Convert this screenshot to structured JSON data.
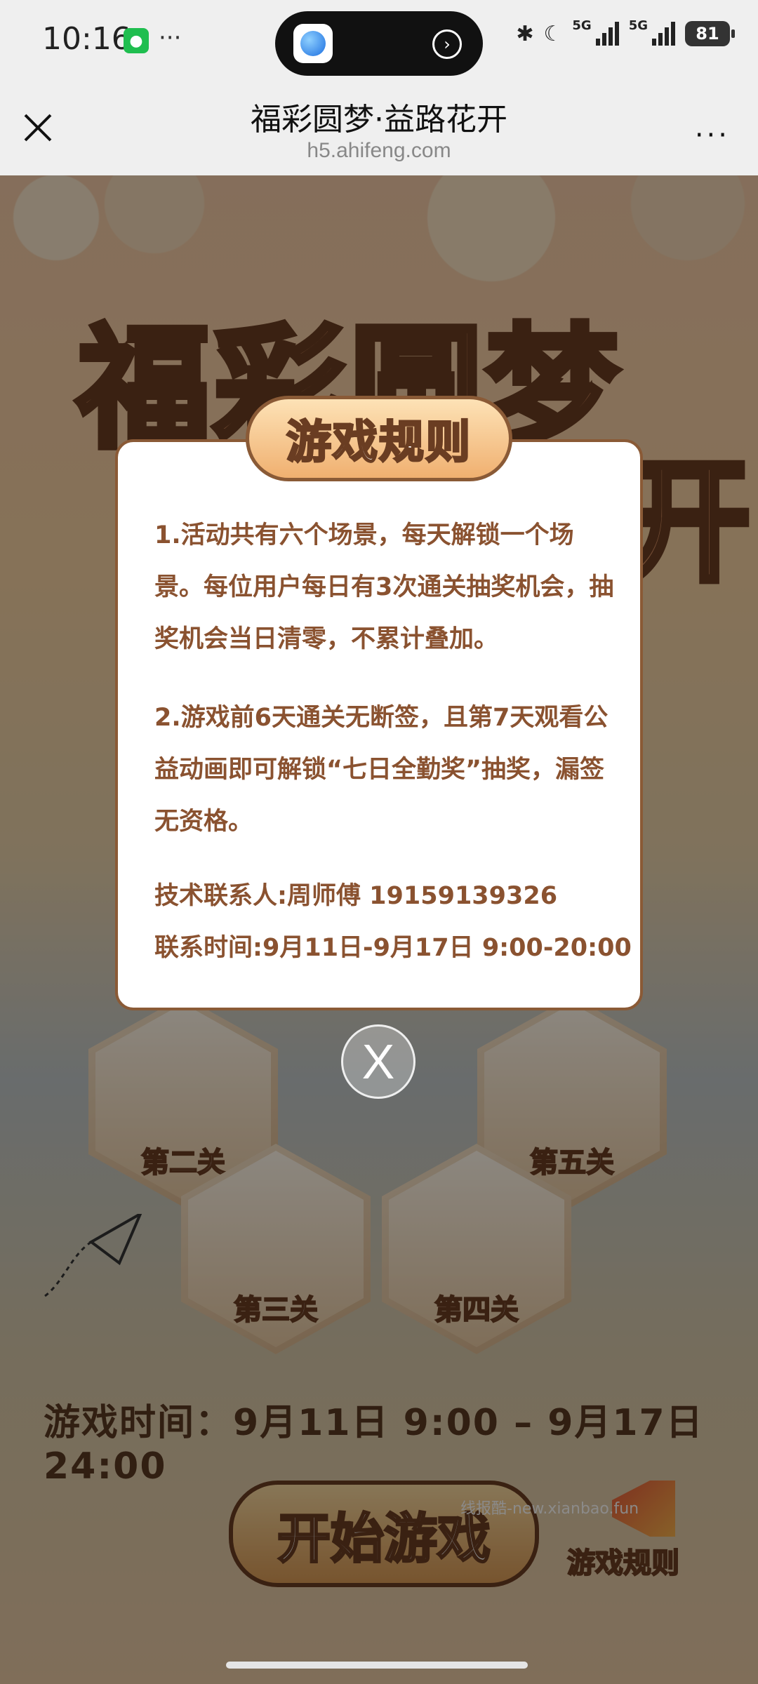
{
  "status_bar": {
    "time": "10:16",
    "more": "···",
    "net1": "5G",
    "net2": "5G",
    "battery": "81"
  },
  "navbar": {
    "title": "福彩圆梦·益路花开",
    "url": "h5.ahifeng.com",
    "more": "···"
  },
  "page": {
    "big_title": "福彩圆梦",
    "big_title_2": "开",
    "levels": [
      "第二关",
      "第五关",
      "第三关",
      "第四关"
    ],
    "game_time": "游戏时间：9月11日 9:00 – 9月17日 24:00",
    "start_button": "开始游戏",
    "rules_button": "游戏规则",
    "watermark": "线报酷-new.xianbao.fun"
  },
  "modal": {
    "title": "游戏规则",
    "rule1": "1.活动共有六个场景，每天解锁一个场景。每位用户每日有3次通关抽奖机会，抽奖机会当日清零，不累计叠加。",
    "rule2": "2.游戏前6天通关无断签，且第7天观看公益动画即可解锁“七日全勤奖”抽奖，漏签无资格。",
    "contact": "技术联系人:周师傅 19159139326",
    "contact_time": "联系时间:9月11日-9月17日   9:00-20:00",
    "close": "X"
  }
}
